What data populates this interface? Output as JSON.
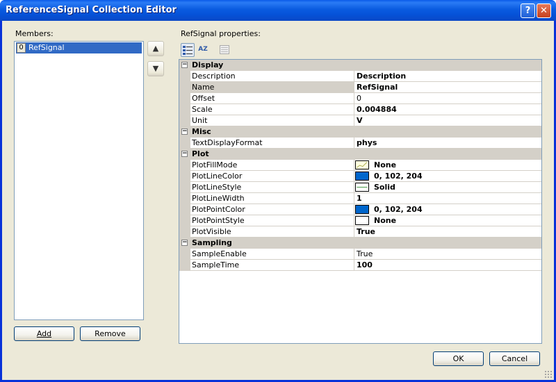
{
  "window": {
    "title": "ReferenceSignal Collection Editor",
    "help_label": "?",
    "close_label": "✕"
  },
  "members": {
    "label": "Members:",
    "items": [
      {
        "index": "0",
        "name": "RefSignal"
      }
    ],
    "add_label": "Add",
    "remove_label": "Remove",
    "up_icon": "▲",
    "down_icon": "▼"
  },
  "properties": {
    "label": "RefSignal properties:",
    "toolbar": {
      "categorized_icon": "categorized-icon",
      "alphabetical_icon": "alphabetical-icon",
      "alphabetical_text": "AZ",
      "property_pages_icon": "property-pages-icon"
    },
    "categories": [
      {
        "name": "Display",
        "toggle": "−",
        "props": [
          {
            "name": "Description",
            "value": "Description",
            "bold": true
          },
          {
            "name": "Name",
            "value": "RefSignal",
            "bold": true,
            "selected": true
          },
          {
            "name": "Offset",
            "value": "0",
            "bold": false
          },
          {
            "name": "Scale",
            "value": "0.004884",
            "bold": true
          },
          {
            "name": "Unit",
            "value": "V",
            "bold": true
          }
        ]
      },
      {
        "name": "Misc",
        "toggle": "−",
        "props": [
          {
            "name": "TextDisplayFormat",
            "value": "phys",
            "bold": true
          }
        ]
      },
      {
        "name": "Plot",
        "toggle": "−",
        "props": [
          {
            "name": "PlotFillMode",
            "value": "None",
            "swatch": "fill-icon"
          },
          {
            "name": "PlotLineColor",
            "value": "0, 102, 204",
            "swatch": "#0066cc"
          },
          {
            "name": "PlotLineStyle",
            "value": "Solid",
            "swatch": "line-style-icon"
          },
          {
            "name": "PlotLineWidth",
            "value": "1",
            "bold": true
          },
          {
            "name": "PlotPointColor",
            "value": "0, 102, 204",
            "swatch": "#0066cc"
          },
          {
            "name": "PlotPointStyle",
            "value": "None",
            "swatch": "#ffffff"
          },
          {
            "name": "PlotVisible",
            "value": "True",
            "bold": true
          }
        ]
      },
      {
        "name": "Sampling",
        "toggle": "−",
        "props": [
          {
            "name": "SampleEnable",
            "value": "True",
            "bold": false
          },
          {
            "name": "SampleTime",
            "value": "100",
            "bold": true
          }
        ]
      }
    ]
  },
  "buttons": {
    "ok_label": "OK",
    "cancel_label": "Cancel"
  }
}
